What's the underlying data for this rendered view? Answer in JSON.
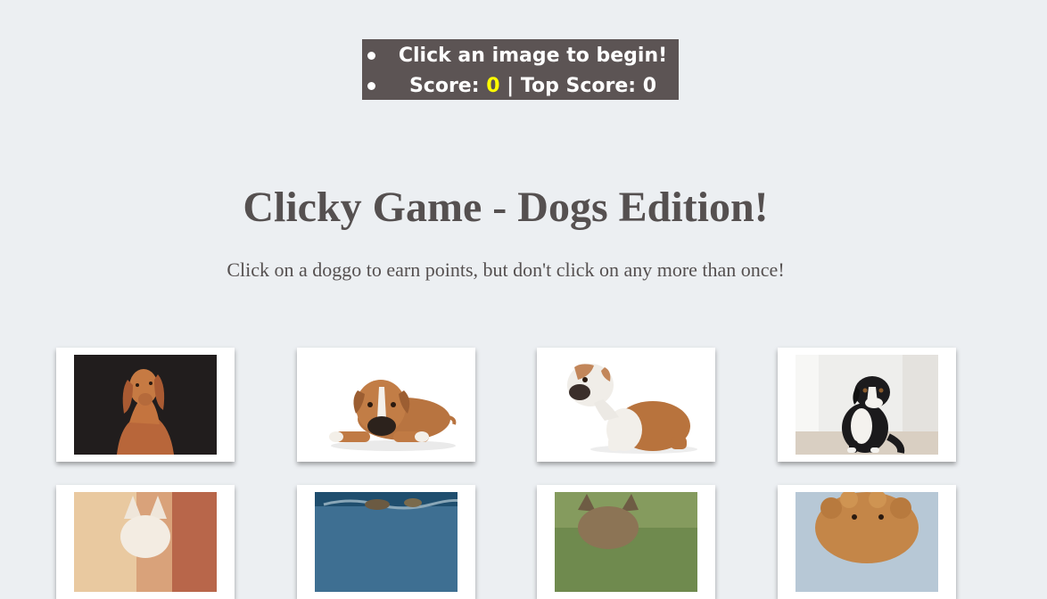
{
  "nav": {
    "message": "Click an image to begin!",
    "score_label": "Score:",
    "score": "0",
    "separator": "|",
    "top_score_label": "Top Score:",
    "top_score": "0"
  },
  "header": {
    "title": "Clicky Game - Dogs Edition!",
    "subtitle": "Click on a doggo to earn points, but don't click on any more than once!"
  },
  "colors": {
    "background": "#eceff2",
    "nav_background": "#5c5454",
    "score_highlight": "#ffff00",
    "text": "#555050"
  },
  "cards": [
    {
      "icon": "vizsla-dog-photo"
    },
    {
      "icon": "boxer-dog-photo"
    },
    {
      "icon": "bulldog-photo"
    },
    {
      "icon": "bernese-mountain-dog-photo"
    },
    {
      "icon": "chihuahua-dog-photo"
    },
    {
      "icon": "dog-in-water-photo"
    },
    {
      "icon": "yorkie-dog-photo"
    },
    {
      "icon": "poodle-dog-photo"
    }
  ]
}
